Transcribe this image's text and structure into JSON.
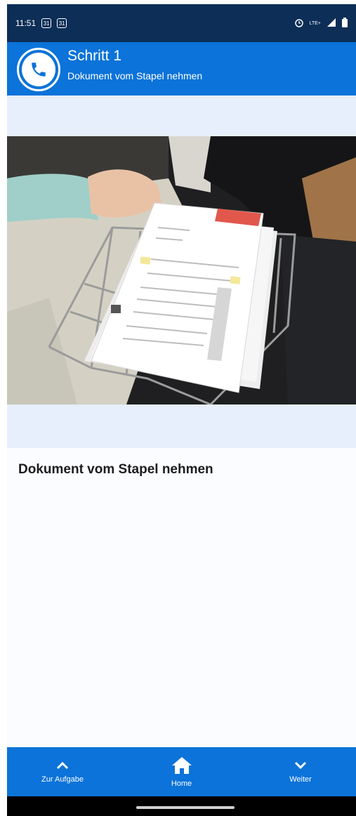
{
  "status_bar": {
    "time": "11:51",
    "cal1": "31",
    "cal2": "31",
    "network": "LTE+",
    "icons": [
      "calendar-icon",
      "calendar-icon",
      "alarm-icon",
      "signal-icon",
      "battery-icon"
    ]
  },
  "header": {
    "title": "Schritt 1",
    "subtitle": "Dokument vom Stapel nehmen",
    "icon": "phone-icon"
  },
  "content": {
    "heading": "Dokument vom Stapel nehmen"
  },
  "bottom_nav": {
    "items": [
      {
        "label": "Zur Aufgabe",
        "icon": "chevron-up-icon"
      },
      {
        "label": "Home",
        "icon": "home-icon"
      },
      {
        "label": "Weiter",
        "icon": "chevron-down-icon"
      }
    ]
  },
  "colors": {
    "status_bar": "#0c2e57",
    "app_bar": "#0b73d9",
    "band": "#e6effb",
    "doc_logo": "#e2574c"
  }
}
